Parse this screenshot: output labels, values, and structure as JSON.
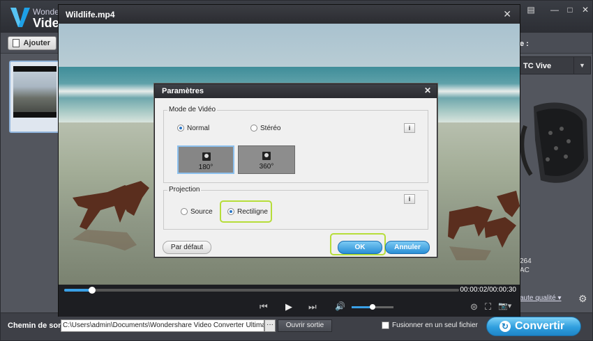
{
  "app": {
    "brand": "Wonder",
    "product": "Video",
    "window_controls": [
      "▤",
      "—",
      "□",
      "✕"
    ],
    "add_button_label": "Ajouter",
    "output_format_label": "e :",
    "device_value": "TC Vive",
    "specs": [
      "264",
      "AC"
    ],
    "quality_link": "aute qualité ▾",
    "output_path_label": "Chemin de sorti",
    "output_path_value": "C:\\Users\\admin\\Documents\\Wondershare Video Converter Ultimate\\Out",
    "browse_label": "···",
    "open_output_label": "Ouvrir sortie",
    "merge_label": "Fusionner en un seul fichier",
    "convert_label": "Convertir",
    "colors": {
      "accent": "#2a8fd6",
      "highlight": "#b6dd39"
    }
  },
  "player": {
    "title": "Wildlife.mp4",
    "close_glyph": "✕",
    "timecode": "00:00:02/00:00:30",
    "progress": 0.07,
    "volume": 0.5,
    "controls": {
      "prev": "⏮",
      "play": "▶",
      "next": "⏭",
      "volume": "🔊",
      "vr": "⊜",
      "fullscreen": "⛶",
      "snapshot": "📷▾"
    }
  },
  "dialog": {
    "title": "Paramètres",
    "close_glyph": "✕",
    "video_mode_group": "Mode de Vidéo",
    "mode_normal": "Normal",
    "mode_stereo": "Stéréo",
    "selected_mode": "Normal",
    "tiles": [
      "180°",
      "360°"
    ],
    "selected_tile": "180°",
    "projection_group": "Projection",
    "projection_source": "Source",
    "projection_rectilinear": "Rectiligne",
    "selected_projection": "Rectiligne",
    "info_glyph": "i",
    "default_button": "Par défaut",
    "ok_button": "OK",
    "cancel_button": "Annuler"
  }
}
